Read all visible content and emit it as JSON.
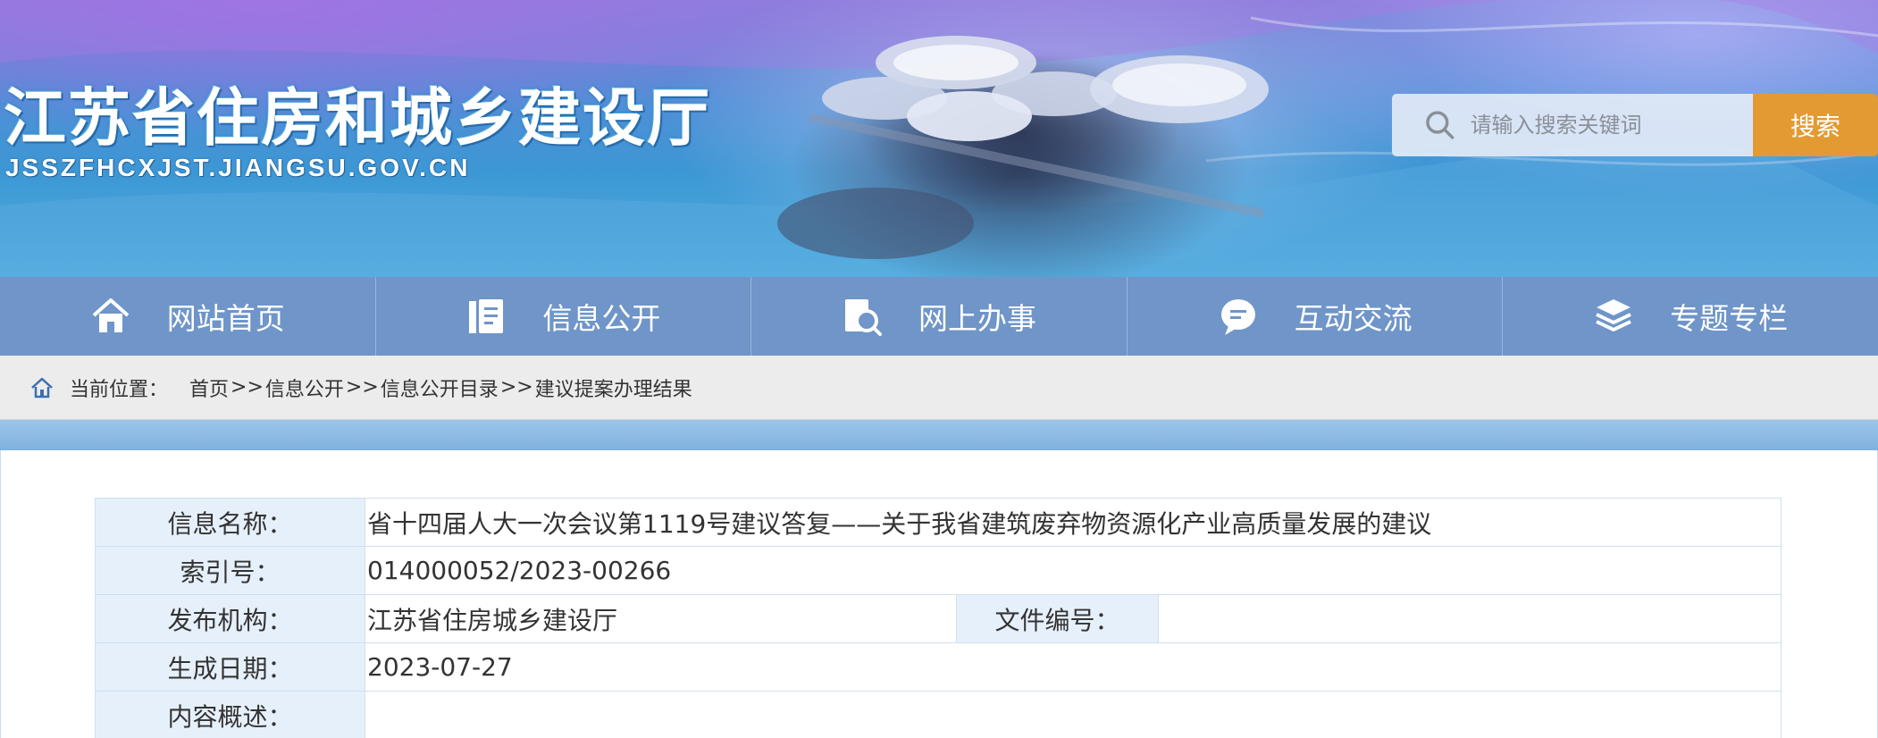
{
  "header": {
    "site_title": "江苏省住房和城乡建设厅",
    "site_url": "JSSZFHCXJST.JIANGSU.GOV.CN",
    "search": {
      "placeholder": "请输入搜索关键词",
      "button_label": "搜索",
      "icon": "search-icon"
    }
  },
  "nav": {
    "items": [
      {
        "label": "网站首页",
        "icon": "home-icon"
      },
      {
        "label": "信息公开",
        "icon": "document-icon"
      },
      {
        "label": "网上办事",
        "icon": "magnifier-document-icon"
      },
      {
        "label": "互动交流",
        "icon": "chat-bubble-icon"
      },
      {
        "label": "专题专栏",
        "icon": "layers-icon"
      }
    ]
  },
  "breadcrumb": {
    "label": "当前位置：",
    "separator": ">>",
    "items": [
      "首页",
      "信息公开",
      "信息公开目录",
      "建议提案办理结果"
    ]
  },
  "info": {
    "name_label": "信息名称：",
    "name_value": "省十四届人大一次会议第1119号建议答复——关于我省建筑废弃物资源化产业高质量发展的建议",
    "index_label": "索引号：",
    "index_value": "014000052/2023-00266",
    "publisher_label": "发布机构：",
    "publisher_value": "江苏省住房城乡建设厅",
    "docno_label": "文件编号：",
    "docno_value": "",
    "date_label": "生成日期：",
    "date_value": "2023-07-27",
    "summary_label": "内容概述：",
    "summary_value": ""
  },
  "colors": {
    "nav_bg": "#6f95c9",
    "search_button": "#e49a32",
    "table_key_bg": "#e6f0fb",
    "table_border": "#cfdff0"
  }
}
